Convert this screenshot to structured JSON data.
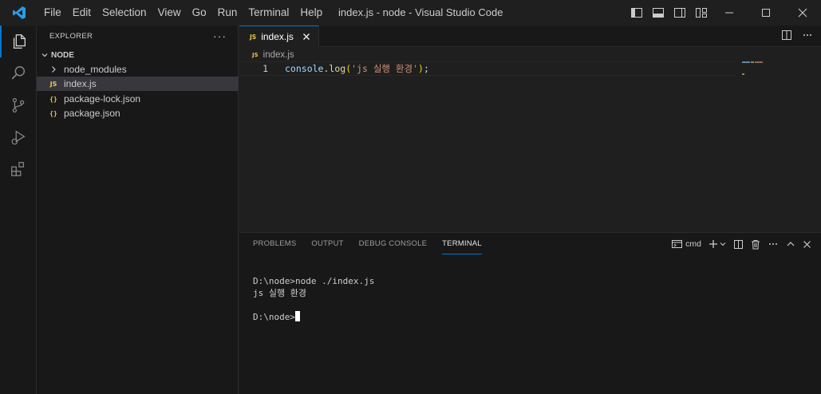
{
  "window": {
    "title": "index.js - node - Visual Studio Code",
    "menu": [
      "File",
      "Edit",
      "Selection",
      "View",
      "Go",
      "Run",
      "Terminal",
      "Help"
    ]
  },
  "sidebar": {
    "header": "EXPLORER",
    "more": "···",
    "section": "NODE",
    "items": [
      {
        "label": "node_modules",
        "icon": "chevron-right-icon",
        "type": "folder"
      },
      {
        "label": "index.js",
        "icon": "JS",
        "type": "file",
        "selected": true
      },
      {
        "label": "package-lock.json",
        "icon": "{}",
        "type": "file"
      },
      {
        "label": "package.json",
        "icon": "{}",
        "type": "file"
      }
    ]
  },
  "editor": {
    "tab": {
      "badge": "JS",
      "label": "index.js"
    },
    "breadcrumb": {
      "badge": "JS",
      "label": "index.js"
    },
    "lines": [
      {
        "number": "1",
        "tokens": {
          "obj": "console",
          "dot": ".",
          "fn": "log",
          "open": "(",
          "str": "'js 실행 환경'",
          "close": ")",
          "semi": ";"
        }
      }
    ]
  },
  "panel": {
    "tabs": [
      "PROBLEMS",
      "OUTPUT",
      "DEBUG CONSOLE",
      "TERMINAL"
    ],
    "active_tab": "TERMINAL",
    "shell": "cmd",
    "terminal": {
      "line1": "D:\\node>node ./index.js",
      "line2": "js 실행 환경",
      "line3": "",
      "prompt": "D:\\node>"
    }
  },
  "colors": {
    "accent": "#0078d4",
    "js_badge": "#e8c745",
    "background": "#1f1f1f"
  }
}
